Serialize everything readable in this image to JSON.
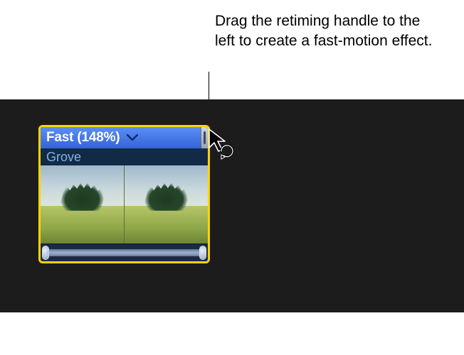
{
  "annotation": {
    "text": "Drag the retiming handle to the left to create a fast-motion effect."
  },
  "clip": {
    "retiming_label": "Fast (148%)",
    "name": "Grove"
  },
  "colors": {
    "clip_border": "#ffd400",
    "retiming_bar": "#3f72e2",
    "handle": "#b6bfcf"
  }
}
